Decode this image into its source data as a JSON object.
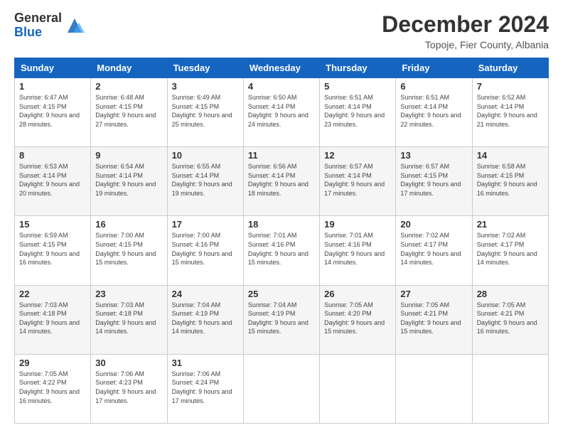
{
  "logo": {
    "general": "General",
    "blue": "Blue"
  },
  "title": "December 2024",
  "subtitle": "Topoje, Fier County, Albania",
  "days_header": [
    "Sunday",
    "Monday",
    "Tuesday",
    "Wednesday",
    "Thursday",
    "Friday",
    "Saturday"
  ],
  "weeks": [
    [
      {
        "day": "1",
        "sunrise": "6:47 AM",
        "sunset": "4:15 PM",
        "daylight": "9 hours and 28 minutes."
      },
      {
        "day": "2",
        "sunrise": "6:48 AM",
        "sunset": "4:15 PM",
        "daylight": "9 hours and 27 minutes."
      },
      {
        "day": "3",
        "sunrise": "6:49 AM",
        "sunset": "4:15 PM",
        "daylight": "9 hours and 25 minutes."
      },
      {
        "day": "4",
        "sunrise": "6:50 AM",
        "sunset": "4:14 PM",
        "daylight": "9 hours and 24 minutes."
      },
      {
        "day": "5",
        "sunrise": "6:51 AM",
        "sunset": "4:14 PM",
        "daylight": "9 hours and 23 minutes."
      },
      {
        "day": "6",
        "sunrise": "6:51 AM",
        "sunset": "4:14 PM",
        "daylight": "9 hours and 22 minutes."
      },
      {
        "day": "7",
        "sunrise": "6:52 AM",
        "sunset": "4:14 PM",
        "daylight": "9 hours and 21 minutes."
      }
    ],
    [
      {
        "day": "8",
        "sunrise": "6:53 AM",
        "sunset": "4:14 PM",
        "daylight": "9 hours and 20 minutes."
      },
      {
        "day": "9",
        "sunrise": "6:54 AM",
        "sunset": "4:14 PM",
        "daylight": "9 hours and 19 minutes."
      },
      {
        "day": "10",
        "sunrise": "6:55 AM",
        "sunset": "4:14 PM",
        "daylight": "9 hours and 19 minutes."
      },
      {
        "day": "11",
        "sunrise": "6:56 AM",
        "sunset": "4:14 PM",
        "daylight": "9 hours and 18 minutes."
      },
      {
        "day": "12",
        "sunrise": "6:57 AM",
        "sunset": "4:14 PM",
        "daylight": "9 hours and 17 minutes."
      },
      {
        "day": "13",
        "sunrise": "6:57 AM",
        "sunset": "4:15 PM",
        "daylight": "9 hours and 17 minutes."
      },
      {
        "day": "14",
        "sunrise": "6:58 AM",
        "sunset": "4:15 PM",
        "daylight": "9 hours and 16 minutes."
      }
    ],
    [
      {
        "day": "15",
        "sunrise": "6:59 AM",
        "sunset": "4:15 PM",
        "daylight": "9 hours and 16 minutes."
      },
      {
        "day": "16",
        "sunrise": "7:00 AM",
        "sunset": "4:15 PM",
        "daylight": "9 hours and 15 minutes."
      },
      {
        "day": "17",
        "sunrise": "7:00 AM",
        "sunset": "4:16 PM",
        "daylight": "9 hours and 15 minutes."
      },
      {
        "day": "18",
        "sunrise": "7:01 AM",
        "sunset": "4:16 PM",
        "daylight": "9 hours and 15 minutes."
      },
      {
        "day": "19",
        "sunrise": "7:01 AM",
        "sunset": "4:16 PM",
        "daylight": "9 hours and 14 minutes."
      },
      {
        "day": "20",
        "sunrise": "7:02 AM",
        "sunset": "4:17 PM",
        "daylight": "9 hours and 14 minutes."
      },
      {
        "day": "21",
        "sunrise": "7:02 AM",
        "sunset": "4:17 PM",
        "daylight": "9 hours and 14 minutes."
      }
    ],
    [
      {
        "day": "22",
        "sunrise": "7:03 AM",
        "sunset": "4:18 PM",
        "daylight": "9 hours and 14 minutes."
      },
      {
        "day": "23",
        "sunrise": "7:03 AM",
        "sunset": "4:18 PM",
        "daylight": "9 hours and 14 minutes."
      },
      {
        "day": "24",
        "sunrise": "7:04 AM",
        "sunset": "4:19 PM",
        "daylight": "9 hours and 14 minutes."
      },
      {
        "day": "25",
        "sunrise": "7:04 AM",
        "sunset": "4:19 PM",
        "daylight": "9 hours and 15 minutes."
      },
      {
        "day": "26",
        "sunrise": "7:05 AM",
        "sunset": "4:20 PM",
        "daylight": "9 hours and 15 minutes."
      },
      {
        "day": "27",
        "sunrise": "7:05 AM",
        "sunset": "4:21 PM",
        "daylight": "9 hours and 15 minutes."
      },
      {
        "day": "28",
        "sunrise": "7:05 AM",
        "sunset": "4:21 PM",
        "daylight": "9 hours and 16 minutes."
      }
    ],
    [
      {
        "day": "29",
        "sunrise": "7:05 AM",
        "sunset": "4:22 PM",
        "daylight": "9 hours and 16 minutes."
      },
      {
        "day": "30",
        "sunrise": "7:06 AM",
        "sunset": "4:23 PM",
        "daylight": "9 hours and 17 minutes."
      },
      {
        "day": "31",
        "sunrise": "7:06 AM",
        "sunset": "4:24 PM",
        "daylight": "9 hours and 17 minutes."
      },
      null,
      null,
      null,
      null
    ]
  ]
}
